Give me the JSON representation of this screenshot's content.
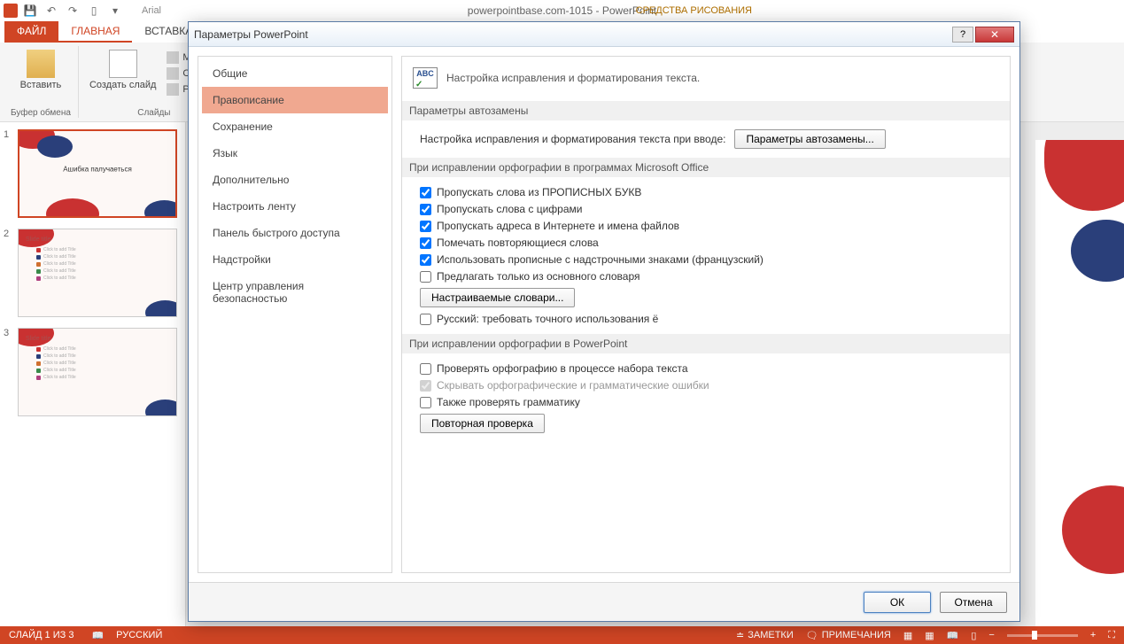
{
  "titlebar": {
    "app_title": "powerpointbase.com-1015 - PowerPoint",
    "context_tab": "СРЕДСТВА РИСОВАНИЯ",
    "font_name": "Arial"
  },
  "ribbon": {
    "tabs": {
      "file": "ФАЙЛ",
      "home": "ГЛАВНАЯ",
      "insert": "ВСТАВКА"
    },
    "paste": "Вставить",
    "clipboard": "Буфер обмена",
    "new_slide": "Создать слайд",
    "slides": "Слайды",
    "layout": "Макет",
    "reset": "Сброс",
    "section": "Раздел"
  },
  "slides": {
    "s1_text": "Ашибка палучаеться",
    "s2_title": "Slide title",
    "s3_title": "Slide title",
    "item": "Click to add Title"
  },
  "statusbar": {
    "slide_count": "СЛАЙД 1 ИЗ 3",
    "lang": "РУССКИЙ",
    "notes": "ЗАМЕТКИ",
    "comments": "ПРИМЕЧАНИЯ"
  },
  "dialog": {
    "title": "Параметры PowerPoint",
    "sidebar": {
      "general": "Общие",
      "proofing": "Правописание",
      "save": "Сохранение",
      "language": "Язык",
      "advanced": "Дополнительно",
      "customize_ribbon": "Настроить ленту",
      "qat": "Панель быстрого доступа",
      "addins": "Надстройки",
      "trust": "Центр управления безопасностью"
    },
    "content": {
      "abc": "ABC",
      "header": "Настройка исправления и форматирования текста.",
      "section_autocorrect": "Параметры автозамены",
      "autocorrect_label": "Настройка исправления и форматирования текста при вводе:",
      "autocorrect_btn": "Параметры автозамены...",
      "section_spelling_office": "При исправлении орфографии в программах Microsoft Office",
      "chk_uppercase": "Пропускать слова из ПРОПИСНЫХ БУКВ",
      "chk_numbers": "Пропускать слова с цифрами",
      "chk_internet": "Пропускать адреса в Интернете и имена файлов",
      "chk_repeated": "Помечать повторяющиеся слова",
      "chk_french": "Использовать прописные с надстрочными знаками (французский)",
      "chk_main_dict": "Предлагать только из основного словаря",
      "custom_dict_btn": "Настраиваемые словари...",
      "chk_russian_yo": "Русский: требовать точного использования ё",
      "section_spelling_pp": "При исправлении орфографии в PowerPoint",
      "chk_check_typing": "Проверять орфографию в процессе набора текста",
      "chk_hide_errors": "Скрывать орфографические и грамматические ошибки",
      "chk_grammar": "Также проверять грамматику",
      "recheck_btn": "Повторная проверка"
    },
    "footer": {
      "ok": "ОК",
      "cancel": "Отмена"
    }
  }
}
